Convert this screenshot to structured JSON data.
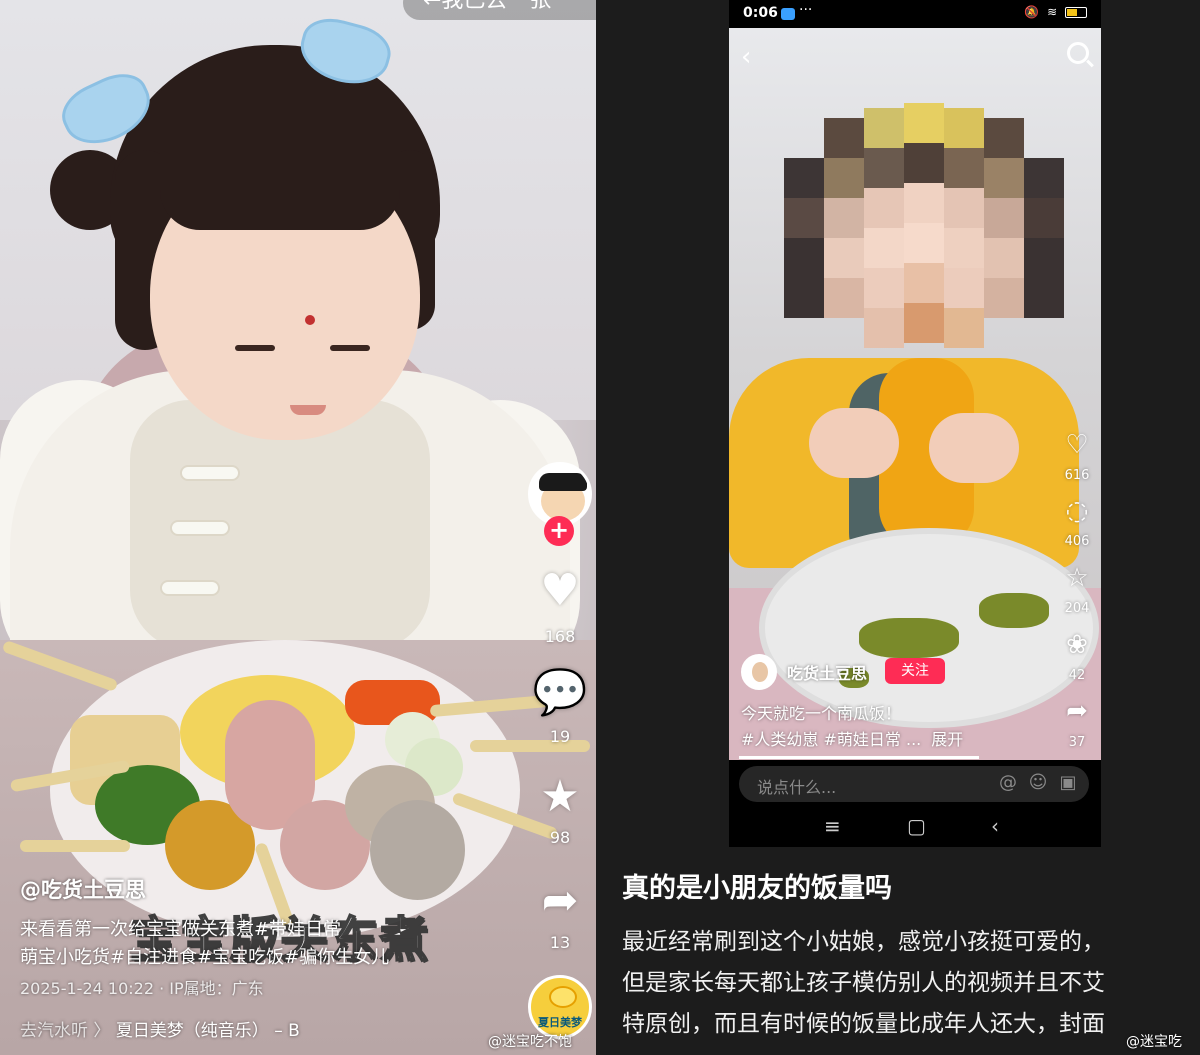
{
  "left_post": {
    "top_chip": "←我已去一张",
    "actions": {
      "like_count": "168",
      "comment_count": "19",
      "favorite_count": "98",
      "share_count": "13"
    },
    "overlay_title": "宝宝版关东煮",
    "author": "@吃货土豆思",
    "description_line1": "来看看第一次给宝宝做关东煮#带娃日常",
    "description_line2": "萌宝小吃货#自注进食#宝宝吃饭#骗你生女儿",
    "meta": "2025-1-24 10:22 · IP属地：广东",
    "music_prefix": "去汽水听 〉",
    "music_title": "夏日美梦（纯音乐） – B",
    "disc_label": "夏日美梦",
    "watermark": "@迷宝吃不饱"
  },
  "right_post": {
    "status": {
      "time": "0:06",
      "more": "···",
      "battery": "83"
    },
    "actions": {
      "like_count": "616",
      "comment_count": "406",
      "favorite_count": "204",
      "gift_count": "42",
      "share_count": "37"
    },
    "username": "吃货土豆思",
    "follow_label": "关注",
    "caption": "今天就吃一个南瓜饭！",
    "tags": "#人类幼崽 #萌娃日常 ...",
    "expand_label": "展开",
    "comment_placeholder": "说点什么...",
    "watermark": "@迷宝吃"
  },
  "article": {
    "title": "真的是小朋友的饭量吗",
    "line1": "最近经常刷到这个小姑娘，感觉小孩挺可爱的，",
    "line2": "但是家长每天都让孩子模仿别人的视频并且不艾",
    "line3": "特原创，而且有时候的饭量比成年人还大，封面"
  }
}
